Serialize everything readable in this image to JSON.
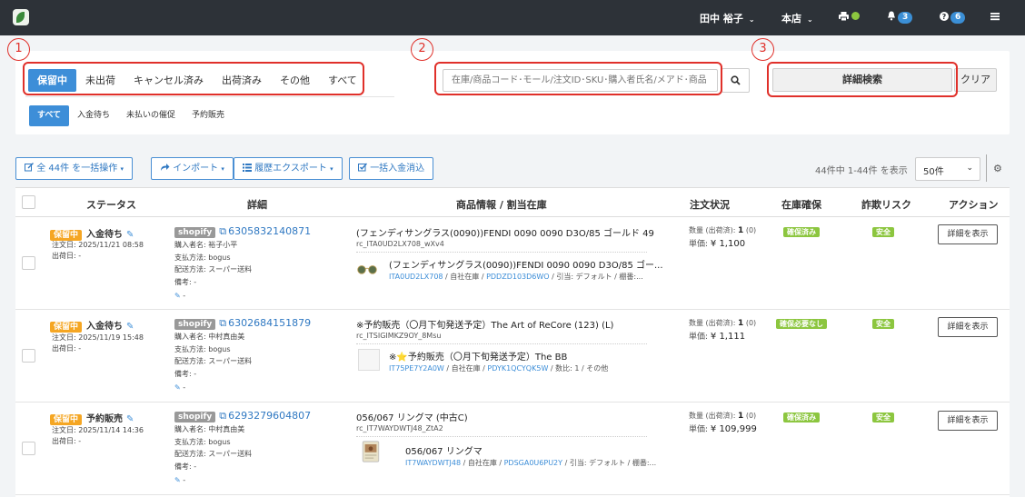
{
  "topbar": {
    "user": "田中 裕子",
    "store": "本店",
    "notifications_count": "3",
    "help_count": "6"
  },
  "tabs": [
    "保留中",
    "未出荷",
    "キャンセル済み",
    "出荷済み",
    "その他",
    "すべて"
  ],
  "subtabs": [
    "すべて",
    "入金待ち",
    "未払いの催促",
    "予約販売"
  ],
  "search": {
    "placeholder": "在庫/商品コード･モール/注文ID･SKU･購入者氏名/メアド･商品",
    "detail_button": "詳細検索",
    "clear_button": "クリア"
  },
  "annotations": [
    "1",
    "2",
    "3"
  ],
  "actions": {
    "bulk": "全 44件 を一括操作",
    "import": "インポート",
    "export": "履歴エクスポート",
    "payment": "一括入金消込"
  },
  "paging": {
    "count_text": "44件中 1-44件 を表示",
    "per_page": "50件"
  },
  "headers": [
    "ステータス",
    "詳細",
    "商品情報 / 割当在庫",
    "注文状況",
    "在庫確保",
    "詐欺リスク",
    "アクション"
  ],
  "rows": [
    {
      "status_tag": "保留中",
      "status": "入金待ち",
      "order_date": "注文日: 2025/11/21 08:58",
      "ship_date": "出荷日: -",
      "shop": "shopify",
      "order_id": "6305832140871",
      "buyer": "購入者名: 裕子小平",
      "payment": "支払方法: bogus",
      "delivery": "配送方法: スーパー送料",
      "note": "備考: -",
      "edit": "-",
      "product_title": "(フェンディサングラス(0090))FENDI 0090 0090 D3O/85 ゴールド 49",
      "product_code": "rc_ITA0UD2LX708_wXv4",
      "sub_title": "(フェンディサングラス(0090))FENDI 0090 0090 D3O/85 ゴー...",
      "sub_code": "ITA0UD2LX708",
      "sub_sep1": " / 自社在庫 / ",
      "sub_code2": "PDDZD103D6WO",
      "sub_rest": " / 引当: デフォルト / 棚番:...",
      "qty_label": "数量 (出荷済): ",
      "qty": "1",
      "qty_shipped": " (0)",
      "price_label": "単価: ",
      "price": "¥ 1,100",
      "stock": "確保済み",
      "risk": "安全",
      "action": "詳細を表示"
    },
    {
      "status_tag": "保留中",
      "status": "入金待ち",
      "order_date": "注文日: 2025/11/19 15:48",
      "ship_date": "出荷日: -",
      "shop": "shopify",
      "order_id": "6302684151879",
      "buyer": "購入者名: 中村真由美",
      "payment": "支払方法: bogus",
      "delivery": "配送方法: スーパー送料",
      "note": "備考: -",
      "edit": "-",
      "product_title": "※予約販売（〇月下旬発送予定）The Art of ReCore (123) (L)",
      "product_code": "rc_ITSIGIMKZ9OY_8Msu",
      "sub_title": "※⭐予約販売（〇月下旬発送予定）The BB",
      "sub_code": "IT75PE7Y2A0W",
      "sub_sep1": " / 自社在庫 / ",
      "sub_code2": "PDYK1QCYQK5W",
      "sub_rest": " / 数比: 1 / その他",
      "qty_label": "数量 (出荷済): ",
      "qty": "1",
      "qty_shipped": " (0)",
      "price_label": "単価: ",
      "price": "¥ 1,111",
      "stock": "確保必要なし",
      "risk": "安全",
      "action": "詳細を表示"
    },
    {
      "status_tag": "保留中",
      "status": "予約販売",
      "order_date": "注文日: 2025/11/14 14:36",
      "ship_date": "出荷日: -",
      "shop": "shopify",
      "order_id": "6293279604807",
      "buyer": "購入者名: 中村真由美",
      "payment": "支払方法: bogus",
      "delivery": "配送方法: スーパー送料",
      "note": "備考: -",
      "edit": "-",
      "product_title": "056/067 リングマ (中古C)",
      "product_code": "rc_IT7WAYDWTJ48_ZtA2",
      "sub_title": "056/067 リングマ",
      "sub_code": "IT7WAYDWTJ48",
      "sub_sep1": " / 自社在庫 / ",
      "sub_code2": "PDSGA0U6PU2Y",
      "sub_rest": " / 引当: デフォルト / 棚番:...",
      "qty_label": "数量 (出荷済): ",
      "qty": "1",
      "qty_shipped": " (0)",
      "price_label": "単価: ",
      "price": "¥ 109,999",
      "stock": "確保済み",
      "risk": "安全",
      "action": "詳細を表示"
    }
  ],
  "colors": {
    "topbar": "#2d3238",
    "accent": "#3d8ed8",
    "hold_tag": "#f5a623",
    "ok_tag": "#8cc63f",
    "annotation_red": "#e0302a"
  },
  "icons": [
    "logo-icon",
    "chevron-down-icon",
    "printer-icon",
    "bell-icon",
    "help-icon",
    "hamburger-icon",
    "search-icon",
    "pencil-icon",
    "external-link-icon",
    "share-icon",
    "list-icon",
    "checkbox-icon",
    "gear-icon"
  ]
}
